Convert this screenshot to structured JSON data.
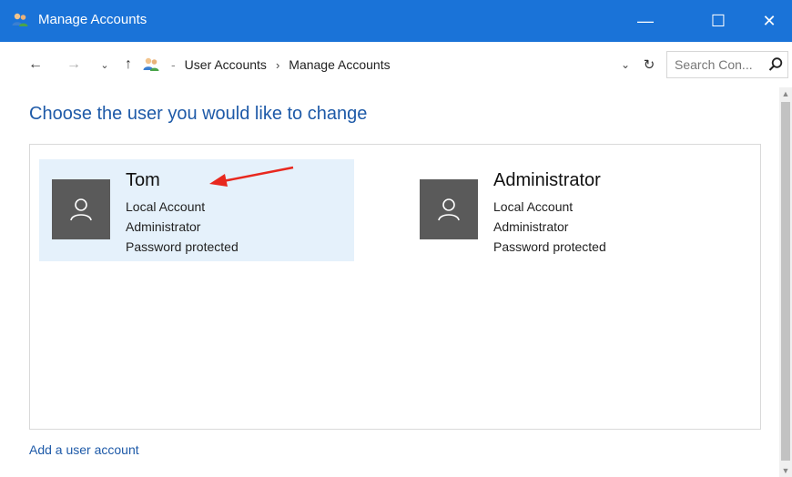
{
  "window": {
    "title": "Manage Accounts",
    "controls": {
      "minimize": "—",
      "maximize": "☐",
      "close": "✕"
    }
  },
  "navigation": {
    "back": "←",
    "forward": "→",
    "recent": "⌄",
    "up": "↑",
    "breadcrumb": [
      "User Accounts",
      "Manage Accounts"
    ],
    "breadcrumb_separator": "›",
    "address_dropdown": "⌄",
    "refresh": "↻",
    "search_placeholder": "Search Con..."
  },
  "main": {
    "heading": "Choose the user you would like to change",
    "accounts": [
      {
        "name": "Tom",
        "type": "Local Account",
        "role": "Administrator",
        "status": "Password protected",
        "selected": true
      },
      {
        "name": "Administrator",
        "type": "Local Account",
        "role": "Administrator",
        "status": "Password protected",
        "selected": false
      }
    ],
    "add_link": "Add a user account"
  },
  "colors": {
    "titlebar": "#1a73d8",
    "heading": "#1e5aa8",
    "selected_tile": "#e5f1fb",
    "avatar": "#5a5a5a",
    "annotation_arrow": "#e8281e"
  },
  "icons": [
    "users-icon",
    "search-icon",
    "user-avatar-icon",
    "annotation-arrow"
  ]
}
